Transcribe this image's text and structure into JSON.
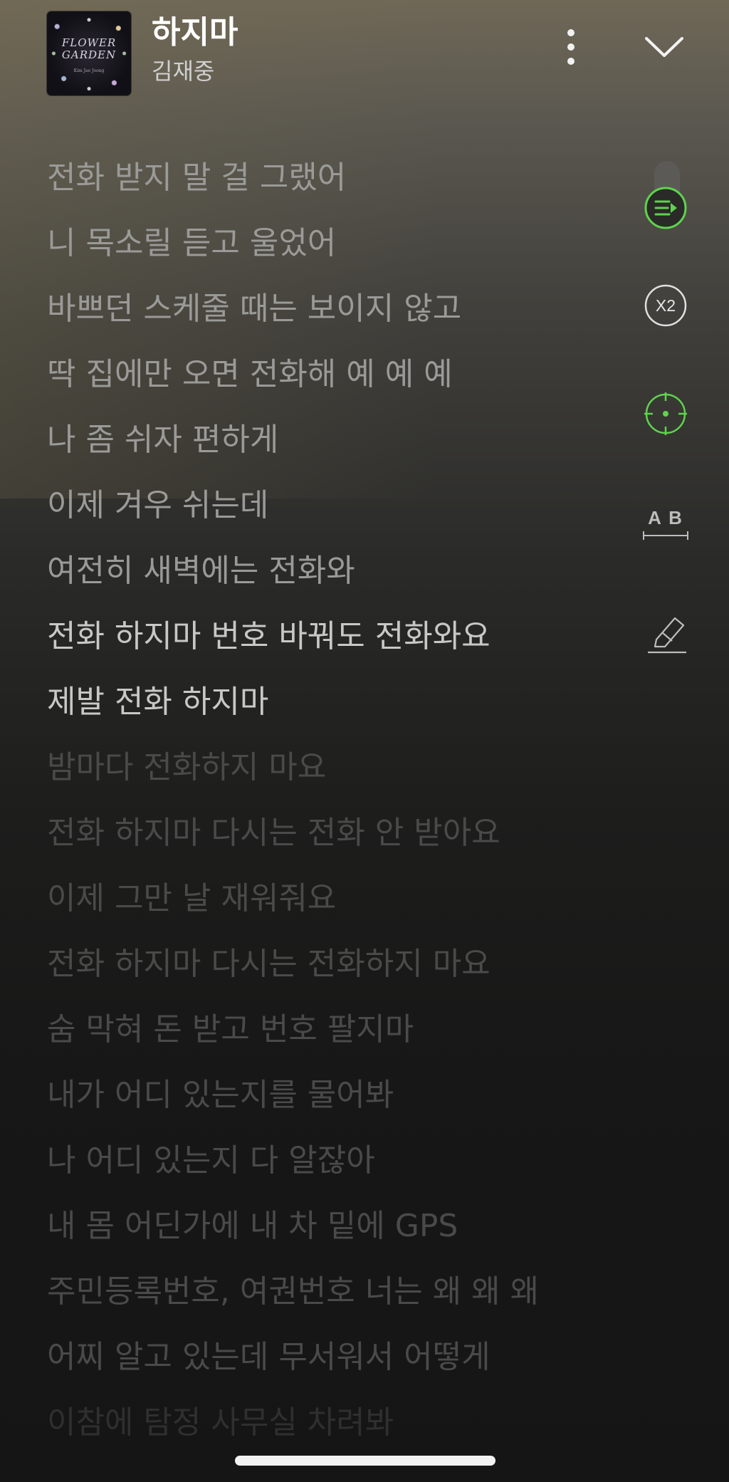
{
  "player": {
    "song_title": "하지마",
    "artist": "김재중",
    "album_art_text": "FLOWER\nGARDEN",
    "album_art_subtext": "Kim Jae Joong"
  },
  "controls": {
    "more_icon": "more-vertical-icon",
    "close_icon": "chevron-down-icon"
  },
  "side_tools": {
    "accent_color": "#5fd34e",
    "icons": [
      "lyrics-sync-icon",
      "speed-icon",
      "focus-icon",
      "translate-icon",
      "highlight-icon"
    ],
    "speed_label": "X2",
    "translate_label": "A B"
  },
  "lyrics": [
    {
      "text": "전화 받지 말 걸 그랬어",
      "state": "past"
    },
    {
      "text": "니 목소릴 듣고 울었어",
      "state": "past"
    },
    {
      "text": "바쁘던 스케줄 때는 보이지 않고",
      "state": "past"
    },
    {
      "text": "딱 집에만 오면 전화해 예 예 예",
      "state": "past"
    },
    {
      "text": "나 좀 쉬자 편하게",
      "state": "past"
    },
    {
      "text": "이제 겨우 쉬는데",
      "state": "past"
    },
    {
      "text": "여전히 새벽에는 전화와",
      "state": "past"
    },
    {
      "text": "전화 하지마 번호 바꿔도 전화와요",
      "state": "current"
    },
    {
      "text": "제발 전화 하지마",
      "state": "current"
    },
    {
      "text": "밤마다 전화하지 마요",
      "state": "upcoming"
    },
    {
      "text": "전화 하지마 다시는 전화 안 받아요",
      "state": "upcoming"
    },
    {
      "text": "이제 그만 날 재워줘요",
      "state": "upcoming"
    },
    {
      "text": "전화 하지마 다시는 전화하지 마요",
      "state": "upcoming"
    },
    {
      "text": "숨 막혀 돈 받고 번호 팔지마",
      "state": "upcoming"
    },
    {
      "text": "내가 어디 있는지를 물어봐",
      "state": "upcoming"
    },
    {
      "text": "나 어디 있는지 다 알잖아",
      "state": "upcoming"
    },
    {
      "text": "내 몸 어딘가에 내 차 밑에 GPS",
      "state": "upcoming"
    },
    {
      "text": "주민등록번호, 여권번호 너는 왜 왜 왜",
      "state": "upcoming"
    },
    {
      "text": "어찌 알고 있는데 무서워서 어떻게",
      "state": "upcoming"
    },
    {
      "text": "이참에 탐정 사무실 차려봐",
      "state": "fade"
    }
  ]
}
